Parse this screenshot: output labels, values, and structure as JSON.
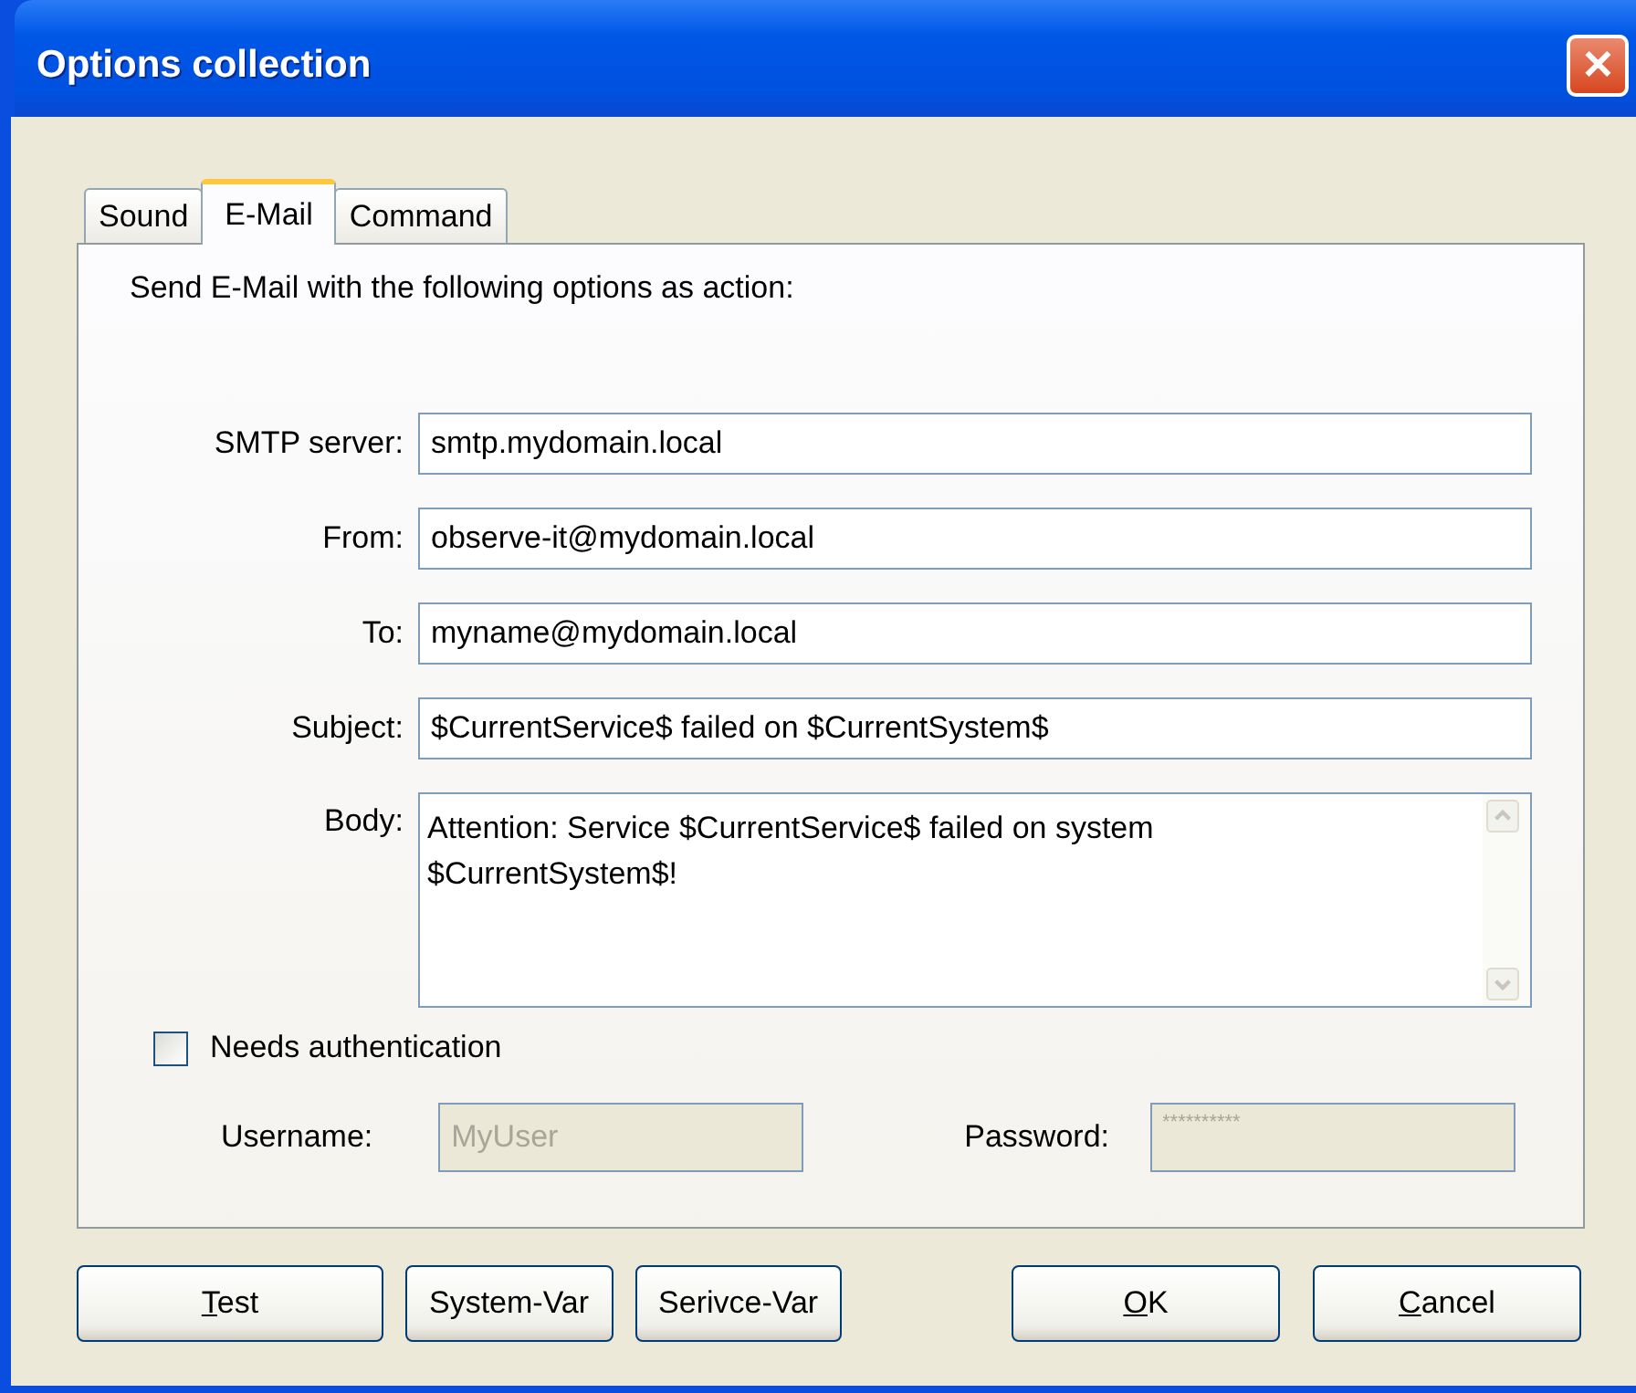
{
  "window": {
    "title": "Options collection",
    "close": "✕"
  },
  "tabs": [
    {
      "label": "Sound",
      "selected": false
    },
    {
      "label": "E-Mail",
      "selected": true
    },
    {
      "label": "Command",
      "selected": false
    }
  ],
  "intro": "Send E-Mail with the following options as action:",
  "fields": [
    {
      "label": "SMTP server:",
      "value": "smtp.mydomain.local"
    },
    {
      "label": "From:",
      "value": "observe-it@mydomain.local"
    },
    {
      "label": "To:",
      "value": "myname@mydomain.local"
    },
    {
      "label": "Subject:",
      "value": "$CurrentService$ failed on $CurrentSystem$"
    }
  ],
  "body": {
    "label": "Body:",
    "value": "Attention: Service $CurrentService$ failed on system $CurrentSystem$!"
  },
  "auth": {
    "label": "Needs authentication",
    "checked": false
  },
  "username": {
    "label": "Username:",
    "value": "MyUser",
    "disabled": true
  },
  "password": {
    "label": "Password:",
    "value": "**********",
    "disabled": true
  },
  "buttons_left": [
    {
      "mnemonic": "T",
      "rest": "est"
    },
    {
      "rest": "System-Var"
    },
    {
      "rest": "Serivce-Var"
    }
  ],
  "buttons_right": [
    {
      "mnemonic": "O",
      "rest": "K"
    },
    {
      "mnemonic": "C",
      "rest": "ancel"
    }
  ]
}
